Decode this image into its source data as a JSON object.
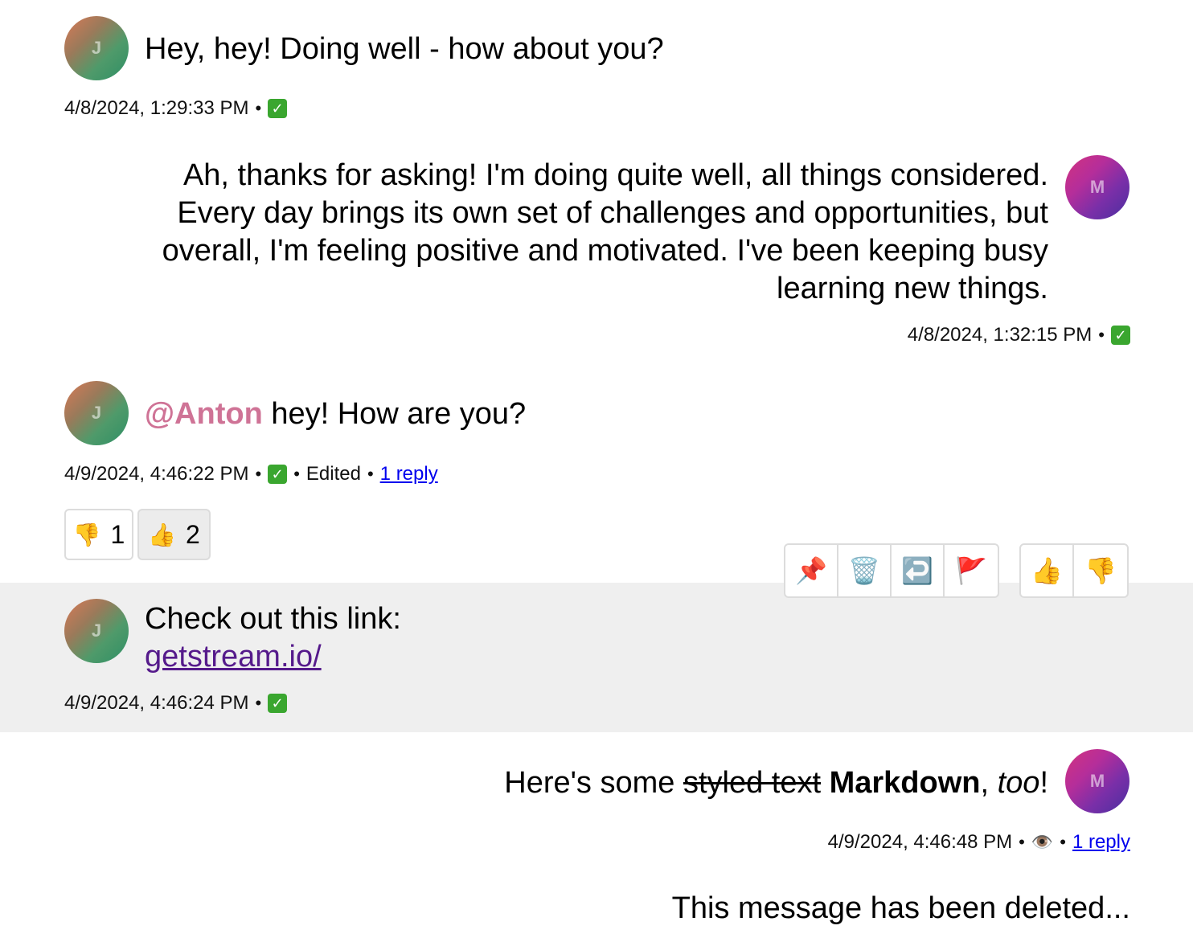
{
  "messages": [
    {
      "avatar_initial": "J",
      "text": "Hey, hey! Doing well - how about you?",
      "timestamp": "4/8/2024, 1:29:33 PM",
      "status_icon": "check-icon"
    },
    {
      "avatar_initial": "M",
      "text_lines": [
        "Ah, thanks for asking! I'm doing quite well, all things considered.",
        "Every day brings its own set of challenges and opportunities, but",
        "overall, I'm feeling positive and motivated. I've been keeping busy",
        "learning new things."
      ],
      "timestamp": "4/8/2024, 1:32:15 PM",
      "status_icon": "check-icon"
    },
    {
      "avatar_initial": "J",
      "mention": "@Anton",
      "text": " hey! How are you?",
      "timestamp": "4/9/2024, 4:46:22 PM",
      "status_icon": "check-icon",
      "edited_label": "Edited",
      "reply_label": "1 reply",
      "reactions": [
        {
          "emoji": "👎",
          "count": "1",
          "active": false
        },
        {
          "emoji": "👍",
          "count": "2",
          "active": true
        }
      ]
    },
    {
      "avatar_initial": "J",
      "text": "Check out this link:",
      "link": "getstream.io/",
      "timestamp": "4/9/2024, 4:46:24 PM",
      "status_icon": "check-icon"
    },
    {
      "avatar_initial": "M",
      "text_parts": {
        "prefix": "Here's some ",
        "strike": "styled text",
        "space": " ",
        "bold": "Markdown",
        "comma": ", ",
        "italic": "too",
        "suffix": "!"
      },
      "timestamp": "4/9/2024, 4:46:48 PM",
      "status_icon": "eye-icon",
      "reply_label": "1 reply"
    },
    {
      "text": "This message has been deleted..."
    }
  ],
  "message_actions": {
    "tools": [
      {
        "name": "pin",
        "glyph": "📌"
      },
      {
        "name": "delete",
        "glyph": "🗑️"
      },
      {
        "name": "reply",
        "glyph": "↩️"
      },
      {
        "name": "flag",
        "glyph": "🚩"
      }
    ],
    "reactions": [
      {
        "name": "thumbs-up",
        "glyph": "👍"
      },
      {
        "name": "thumbs-down",
        "glyph": "👎"
      }
    ]
  },
  "symbols": {
    "separator": "•",
    "check": "✓",
    "eye": "👁️"
  },
  "colors": {
    "mention": "#cf7396",
    "link_visited": "#551a8b",
    "reply_link": "#0000ee",
    "check_green": "#3aa62f",
    "highlight_bg": "#efefef"
  }
}
